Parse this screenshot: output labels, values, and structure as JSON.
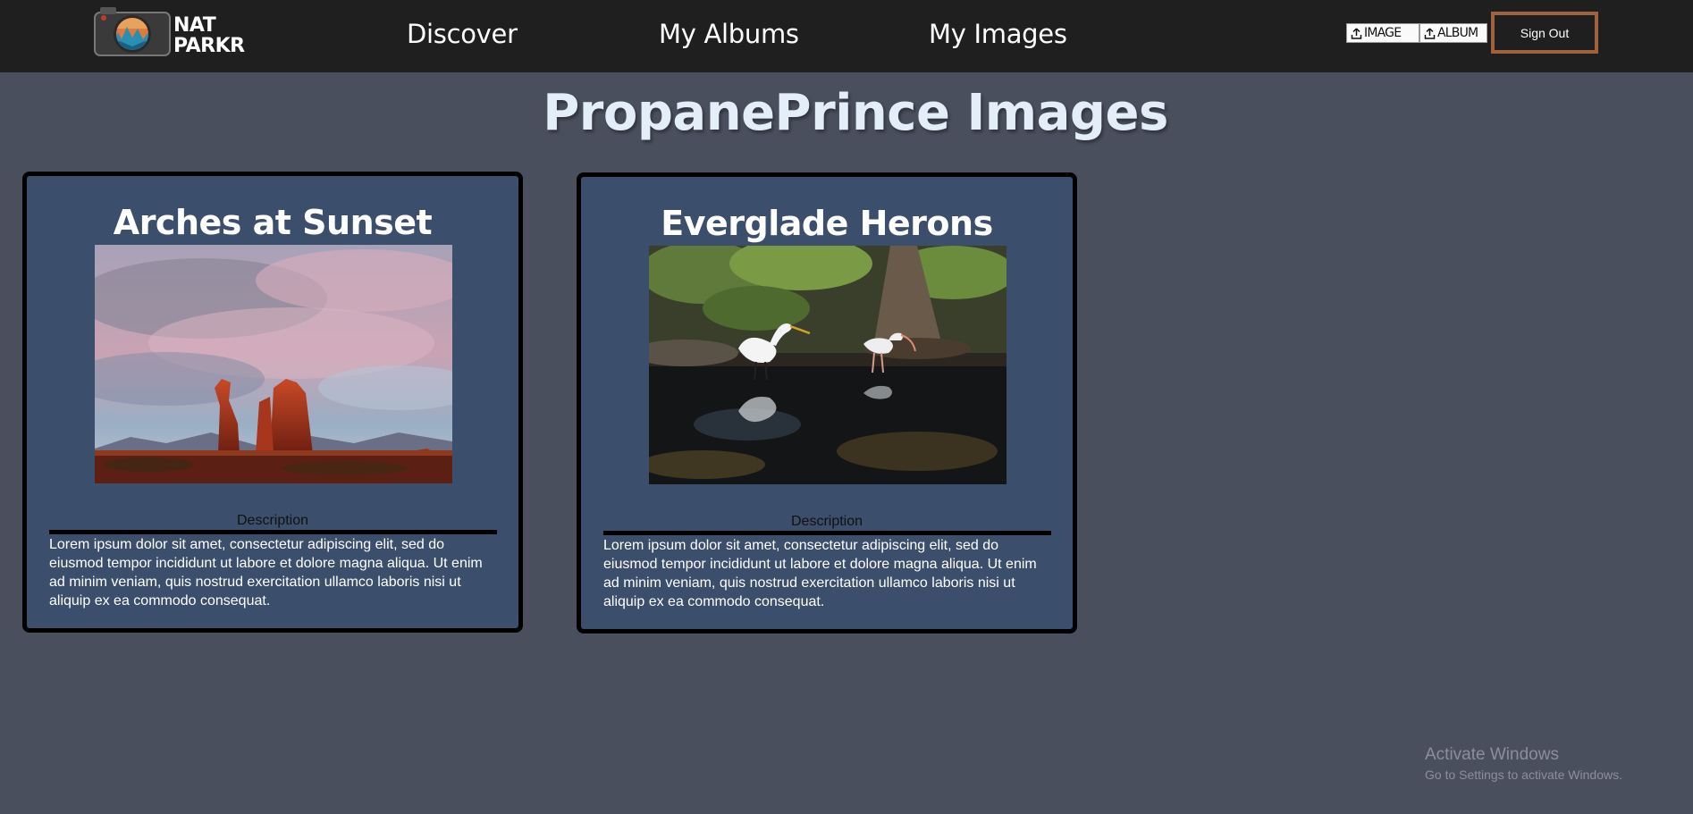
{
  "nav": {
    "logo": {
      "line1": "NAT",
      "line2": "PARKR",
      "icon": "camera-logo-icon"
    },
    "links": [
      {
        "label": "Discover"
      },
      {
        "label": "My Albums"
      },
      {
        "label": "My Images"
      }
    ],
    "upload_image_label": "IMAGE",
    "upload_album_label": "ALBUM",
    "upload_icon": "upload-icon",
    "signout_label": "Sign Out"
  },
  "page_title": "PropanePrince Images",
  "cards": [
    {
      "title": "Arches at Sunset",
      "photo": "red rock arches at sunset under pink clouds",
      "description_label": "Description",
      "description": "Lorem ipsum dolor sit amet, consectetur adipiscing elit, sed do eiusmod tempor incididunt ut labore et dolore magna aliqua. Ut enim ad minim veniam, quis nostrud exercitation ullamco laboris nisi ut aliquip ex ea commodo consequat."
    },
    {
      "title": "Everglade Herons",
      "photo": "two white herons wading in dark water",
      "description_label": "Description",
      "description": "Lorem ipsum dolor sit amet, consectetur adipiscing elit, sed do eiusmod tempor incididunt ut labore et dolore magna aliqua. Ut enim ad minim veniam, quis nostrud exercitation ullamco laboris nisi ut aliquip ex ea commodo consequat."
    }
  ],
  "watermark": {
    "title": "Activate Windows",
    "subtitle": "Go to Settings to activate Windows."
  },
  "colors": {
    "nav_bg": "#1f1f1f",
    "page_bg": "#4a4f5e",
    "card_bg": "#3b4e6b",
    "signout_border": "#a0613d",
    "title_text": "#e3eef9"
  }
}
